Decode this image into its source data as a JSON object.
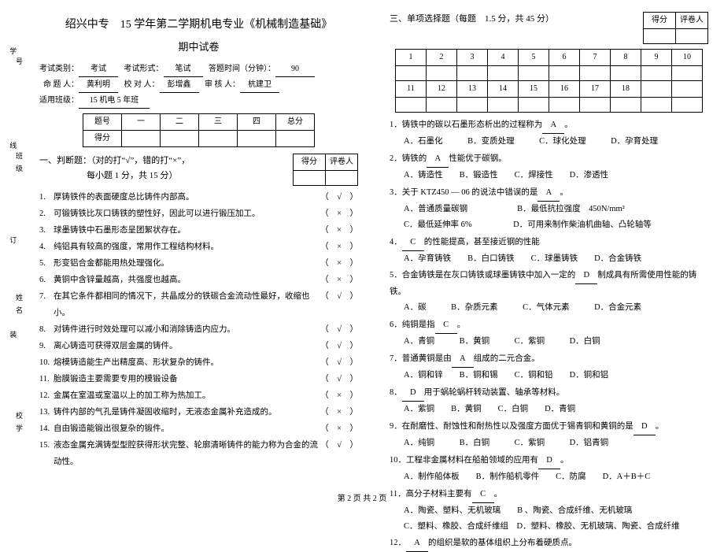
{
  "spine": {
    "xue": "学",
    "xian": "线",
    "ding": "订",
    "zhuang": "装",
    "l_hao": "号",
    "l_ban": "班级",
    "l_xing": "姓名",
    "l_xiao": "校学"
  },
  "header": {
    "title": "绍兴中专　15 学年第二学期机电专业《机械制造基础》",
    "subtitle": "期中试卷",
    "line1_a": "考试类别：",
    "line1_av": "考试",
    "line1_b": "考试形式：",
    "line1_bv": "笔试",
    "line1_c": "答题时间（分钟）：",
    "line1_cv": "90",
    "line2_a": "命 题 人：",
    "line2_av": "黄利明",
    "line2_b": "校 对 人：",
    "line2_bv": "彭增鑫",
    "line2_c": "审 核 人：",
    "line2_cv": "杭建卫",
    "line3_a": "适用班级：",
    "line3_av": "15 机电 5 年班"
  },
  "score1": {
    "c0": "题号",
    "c1": "一",
    "c2": "二",
    "c3": "三",
    "c4": "四",
    "c5": "总分",
    "r": "得分"
  },
  "markbox": {
    "a": "得分",
    "b": "评卷人"
  },
  "sec1": {
    "head1": "一、判断题：（对的打“√”，错的打“×”，",
    "head2": "每小题 1 分，共 15 分）"
  },
  "tf": [
    {
      "n": "1.",
      "t": "厚铸铁件的表面硬度总比铸件内部高。",
      "a": "（　√　）"
    },
    {
      "n": "2.",
      "t": "可锻铸铁比灰口铸铁的塑性好，因此可以进行锻压加工。",
      "a": "（　×　）"
    },
    {
      "n": "3.",
      "t": "球墨铸铁中石墨形态呈团絮状存在。",
      "a": "（　×　）"
    },
    {
      "n": "4.",
      "t": "纯铝具有较高的强度，常用作工程结构材料。",
      "a": "（　×　）"
    },
    {
      "n": "5.",
      "t": "形变铝合金都能用热处理强化。",
      "a": "（　×　）"
    },
    {
      "n": "6.",
      "t": "黄铜中含锌量越高，共强度也越高。",
      "a": "（　×　）"
    },
    {
      "n": "7.",
      "t": "在其它条件都相同的情况下，共晶成分的铁碳合金流动性最好，收缩也小。",
      "a": "（　√　）"
    },
    {
      "n": "8.",
      "t": "对铸件进行时效处理可以减小和消除铸造内应力。",
      "a": "（　√　）"
    },
    {
      "n": "9.",
      "t": "离心铸造可获得双层金属的铸件。",
      "a": "（　√　）"
    },
    {
      "n": "10.",
      "t": "熔模铸造能生产出精度高、形状复杂的铸件。",
      "a": "（　√　）"
    },
    {
      "n": "11.",
      "t": "胎膜锻造主要需要专用的模锻设备",
      "a": "（　√　）"
    },
    {
      "n": "12.",
      "t": "金属在室温或室温以上的加工称为热加工。",
      "a": "（　×　）"
    },
    {
      "n": "13.",
      "t": "铸件内部的气孔是铸件凝固收缩时，无液态金属补充造成的。",
      "a": "（　×　）"
    },
    {
      "n": "14.",
      "t": "自由锻造能锻出很复杂的锻件。",
      "a": "（　×　）"
    },
    {
      "n": "15.",
      "t": "液态金属充满铸型型腔获得形状完整、轮廓清晰铸件的能力称为合金的流动性。",
      "a": "（　√　）"
    }
  ],
  "sec3": {
    "head": "三、单项选择题（每题　1.5 分，共 45 分）"
  },
  "grid": {
    "h": [
      "1",
      "2",
      "3",
      "4",
      "5",
      "6",
      "7",
      "8",
      "9",
      "10"
    ],
    "h2": [
      "11",
      "12",
      "13",
      "14",
      "15",
      "16",
      "17",
      "18",
      "",
      ""
    ]
  },
  "mcq": [
    {
      "n": "1．",
      "stem": "铸铁中的碳以石墨形态析出的过程称为",
      "ans": "A",
      "tail": "。",
      "opts": "A．石墨化　　　B．变质处理　　　C．球化处理　　　D．孕育处理"
    },
    {
      "n": "2．",
      "stem": "铸铁的",
      "ans": "A",
      "tail": "性能优于碳钢。",
      "opts": "A．铸造性　　B．锻造性　　C．焊接性　　D．渗透性"
    },
    {
      "n": "3．",
      "stem": "关于 KTZ450 — 06 的说法中错误的是",
      "ans": "A",
      "tail": "。",
      "opts": "A．普通质量碳钢　　　　　　B．最低抗拉强度　450N/mm²\nC．最低延伸率 6%　　　　　D．可用来制作柴油机曲轴、凸轮轴等"
    },
    {
      "n": "4．",
      "stem": "",
      "ans": "C",
      "tail": "的性能提高，甚至接近钢的性能",
      "opts": "A．孕育铸铁　　B．白口铸铁　　C．球墨铸铁　　D．合金铸铁"
    },
    {
      "n": "5．",
      "stem": "合金铸铁是在灰口铸铁或球墨铸铁中加入一定的",
      "ans": "D",
      "tail": "制成具有所需使用性能的铸铁。",
      "opts": "A．碳　　　B．杂质元素　　　C．气体元素　　　D．合金元素"
    },
    {
      "n": "6．",
      "stem": "纯铜是指",
      "ans": "C",
      "tail": "。",
      "opts": "A．青铜　　　B．黄铜　　　C．紫铜　　　D．白铜"
    },
    {
      "n": "7．",
      "stem": "普通黄铜是由",
      "ans": "A",
      "tail": "组成的二元合金。",
      "opts": "A．铜和锌　　B．铜和锡　　C．铜和铅　　D．铜和铝"
    },
    {
      "n": "8．",
      "stem": "",
      "ans": "D",
      "tail": "用于蜗轮蜗杆转动装置、轴承等材料。",
      "opts": "A．紫铜　　B．黄铜　　C．白铜　　D．青铜"
    },
    {
      "n": "9．",
      "stem": "在耐磨性、耐蚀性和耐热性以及强度方面优于锡青铜和黄铜的是",
      "ans": "D",
      "tail": "。",
      "opts": "A．纯铜　　　B．白铜　　　C．紫铜　　　D．铝青铜"
    },
    {
      "n": "10．",
      "stem": "工程非金属材料在船舶领域的应用有",
      "ans": "D",
      "tail": "。",
      "opts": "A．制作船体板　　B．制作船机零件　　C．防腐　　D．A＋B＋C"
    },
    {
      "n": "11．",
      "stem": "高分子材料主要有",
      "ans": "C",
      "tail": "。",
      "opts": "A．陶瓷、塑料、无机玻璃　　B 、陶瓷、合成纤维、无机玻璃\nC．塑料、橡胶、合成纤维组　D．塑料、橡胶、无机玻璃、陶瓷、合成纤维"
    },
    {
      "n": "12．",
      "stem": "",
      "ans": "A",
      "tail": "的组织是软的基体组织上分布着硬质点。",
      "opts": ""
    }
  ],
  "footer": "第 2 页 共 2 页"
}
